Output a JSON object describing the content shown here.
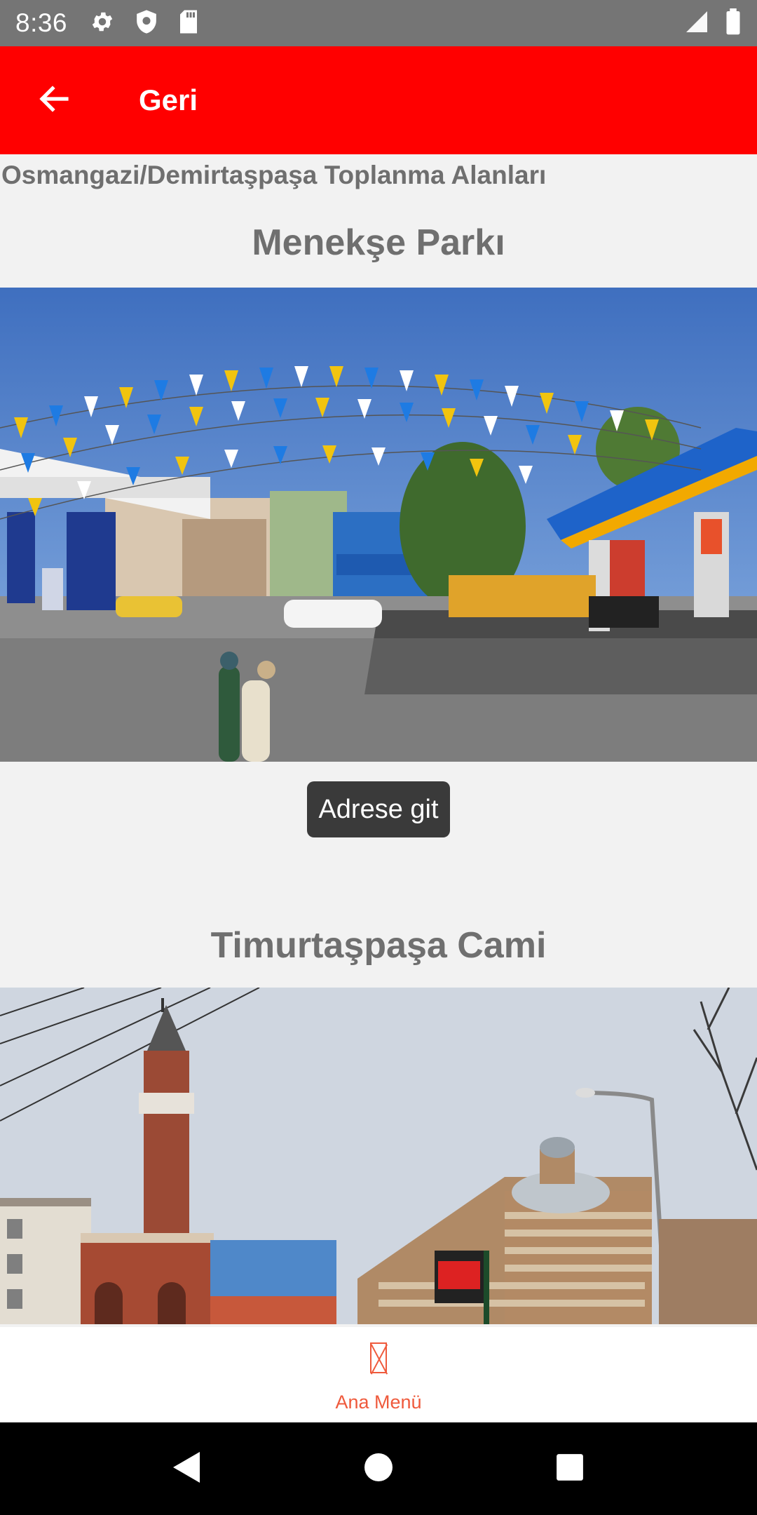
{
  "status_bar": {
    "time": "8:36",
    "icons": [
      "gear-icon",
      "shield-icon",
      "sd-card-icon",
      "signal-icon",
      "battery-icon"
    ]
  },
  "app_bar": {
    "back_icon": "arrow-left-icon",
    "title": "Geri",
    "color": "#ff0000"
  },
  "content": {
    "district_title": "Osmangazi/Demirtaşpaşa Toplanma Alanları",
    "places": [
      {
        "name": "Menekşe Parkı",
        "button_label": "Adrese git"
      },
      {
        "name": "Timurtaşpaşa Cami"
      }
    ]
  },
  "bottom_tab": {
    "icon": "missing-glyph-icon",
    "label": "Ana Menü",
    "color": "#ef5a3c"
  },
  "nav_bar": {
    "buttons": [
      "back-triangle-icon",
      "home-circle-icon",
      "recents-square-icon"
    ]
  }
}
